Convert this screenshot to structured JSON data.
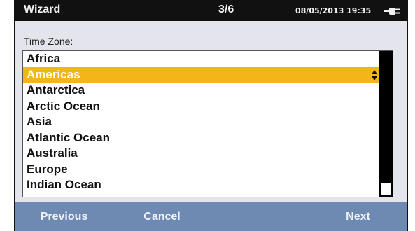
{
  "titlebar": {
    "title": "Wizard",
    "step": "3/6",
    "datetime": "08/05/2013 19:35",
    "power_icon": "plug-icon"
  },
  "timezone": {
    "label": "Time Zone:",
    "selected": "Americas",
    "items": [
      {
        "label": "Africa"
      },
      {
        "label": "Americas",
        "selected": true
      },
      {
        "label": "Antarctica"
      },
      {
        "label": "Arctic Ocean"
      },
      {
        "label": "Asia"
      },
      {
        "label": "Atlantic Ocean"
      },
      {
        "label": "Australia"
      },
      {
        "label": "Europe"
      },
      {
        "label": "Indian Ocean"
      }
    ]
  },
  "softkeys": {
    "previous": "Previous",
    "cancel": "Cancel",
    "blank": "",
    "next": "Next"
  },
  "colors": {
    "titlebar": "#111111",
    "selection": "#f3b518",
    "softkey_bar": "#6e89b2",
    "panel": "#e4e4ec"
  }
}
